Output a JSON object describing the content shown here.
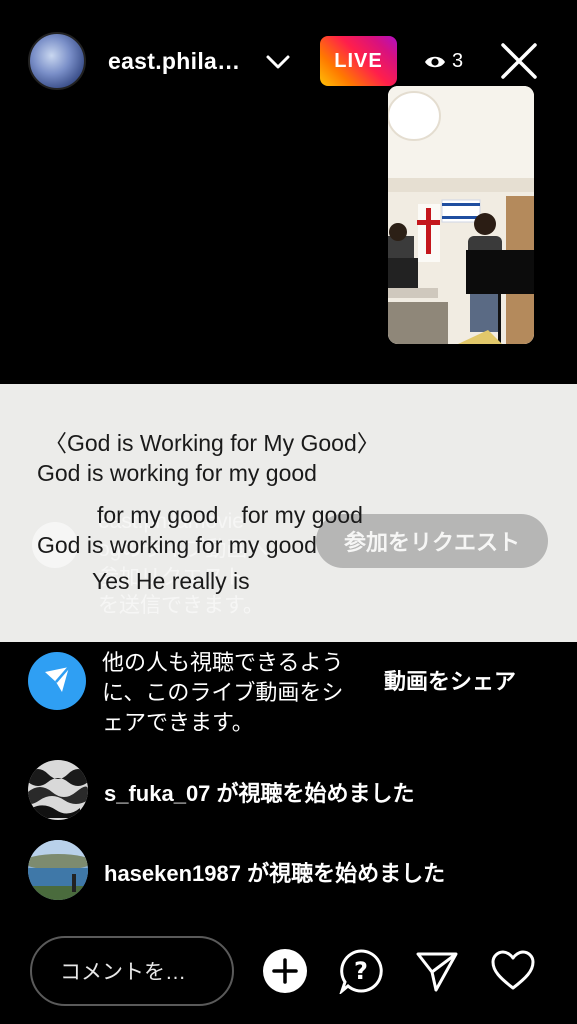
{
  "header": {
    "username": "east.phila…",
    "live_label": "LIVE",
    "viewer_count": "3"
  },
  "lyrics": {
    "line1": "〈God is Working for My Good〉",
    "line2": "God is working for my good",
    "line3": "for my good　for my good",
    "line4": "God is working for my good",
    "line5": "Yes He really is"
  },
  "join_request": {
    "ghost_line1": "east.philamovie",
    "ghost_line2": "ogのライブ動画へ",
    "ghost_line3": "参加リクエスト",
    "ghost_line4": "を送信できます。",
    "button_label": "参加をリクエスト"
  },
  "share": {
    "text": "他の人も視聴できるように、このライブ動画をシェアできます。",
    "button_label": "動画をシェア"
  },
  "comments": [
    {
      "text": "s_fuka_07 が視聴を始めました"
    },
    {
      "text": "haseken1987 が視聴を始めました"
    }
  ],
  "bottom_bar": {
    "comment_placeholder": "コメントを…"
  },
  "colors": {
    "live_gradient_start": "#ffc107",
    "live_gradient_end": "#b110c4",
    "share_icon_bg": "#2f9ff3"
  },
  "icons": [
    "chevron-down-icon",
    "eye-icon",
    "close-icon",
    "send-icon",
    "add-icon",
    "question-icon",
    "direct-share-icon",
    "heart-icon"
  ]
}
